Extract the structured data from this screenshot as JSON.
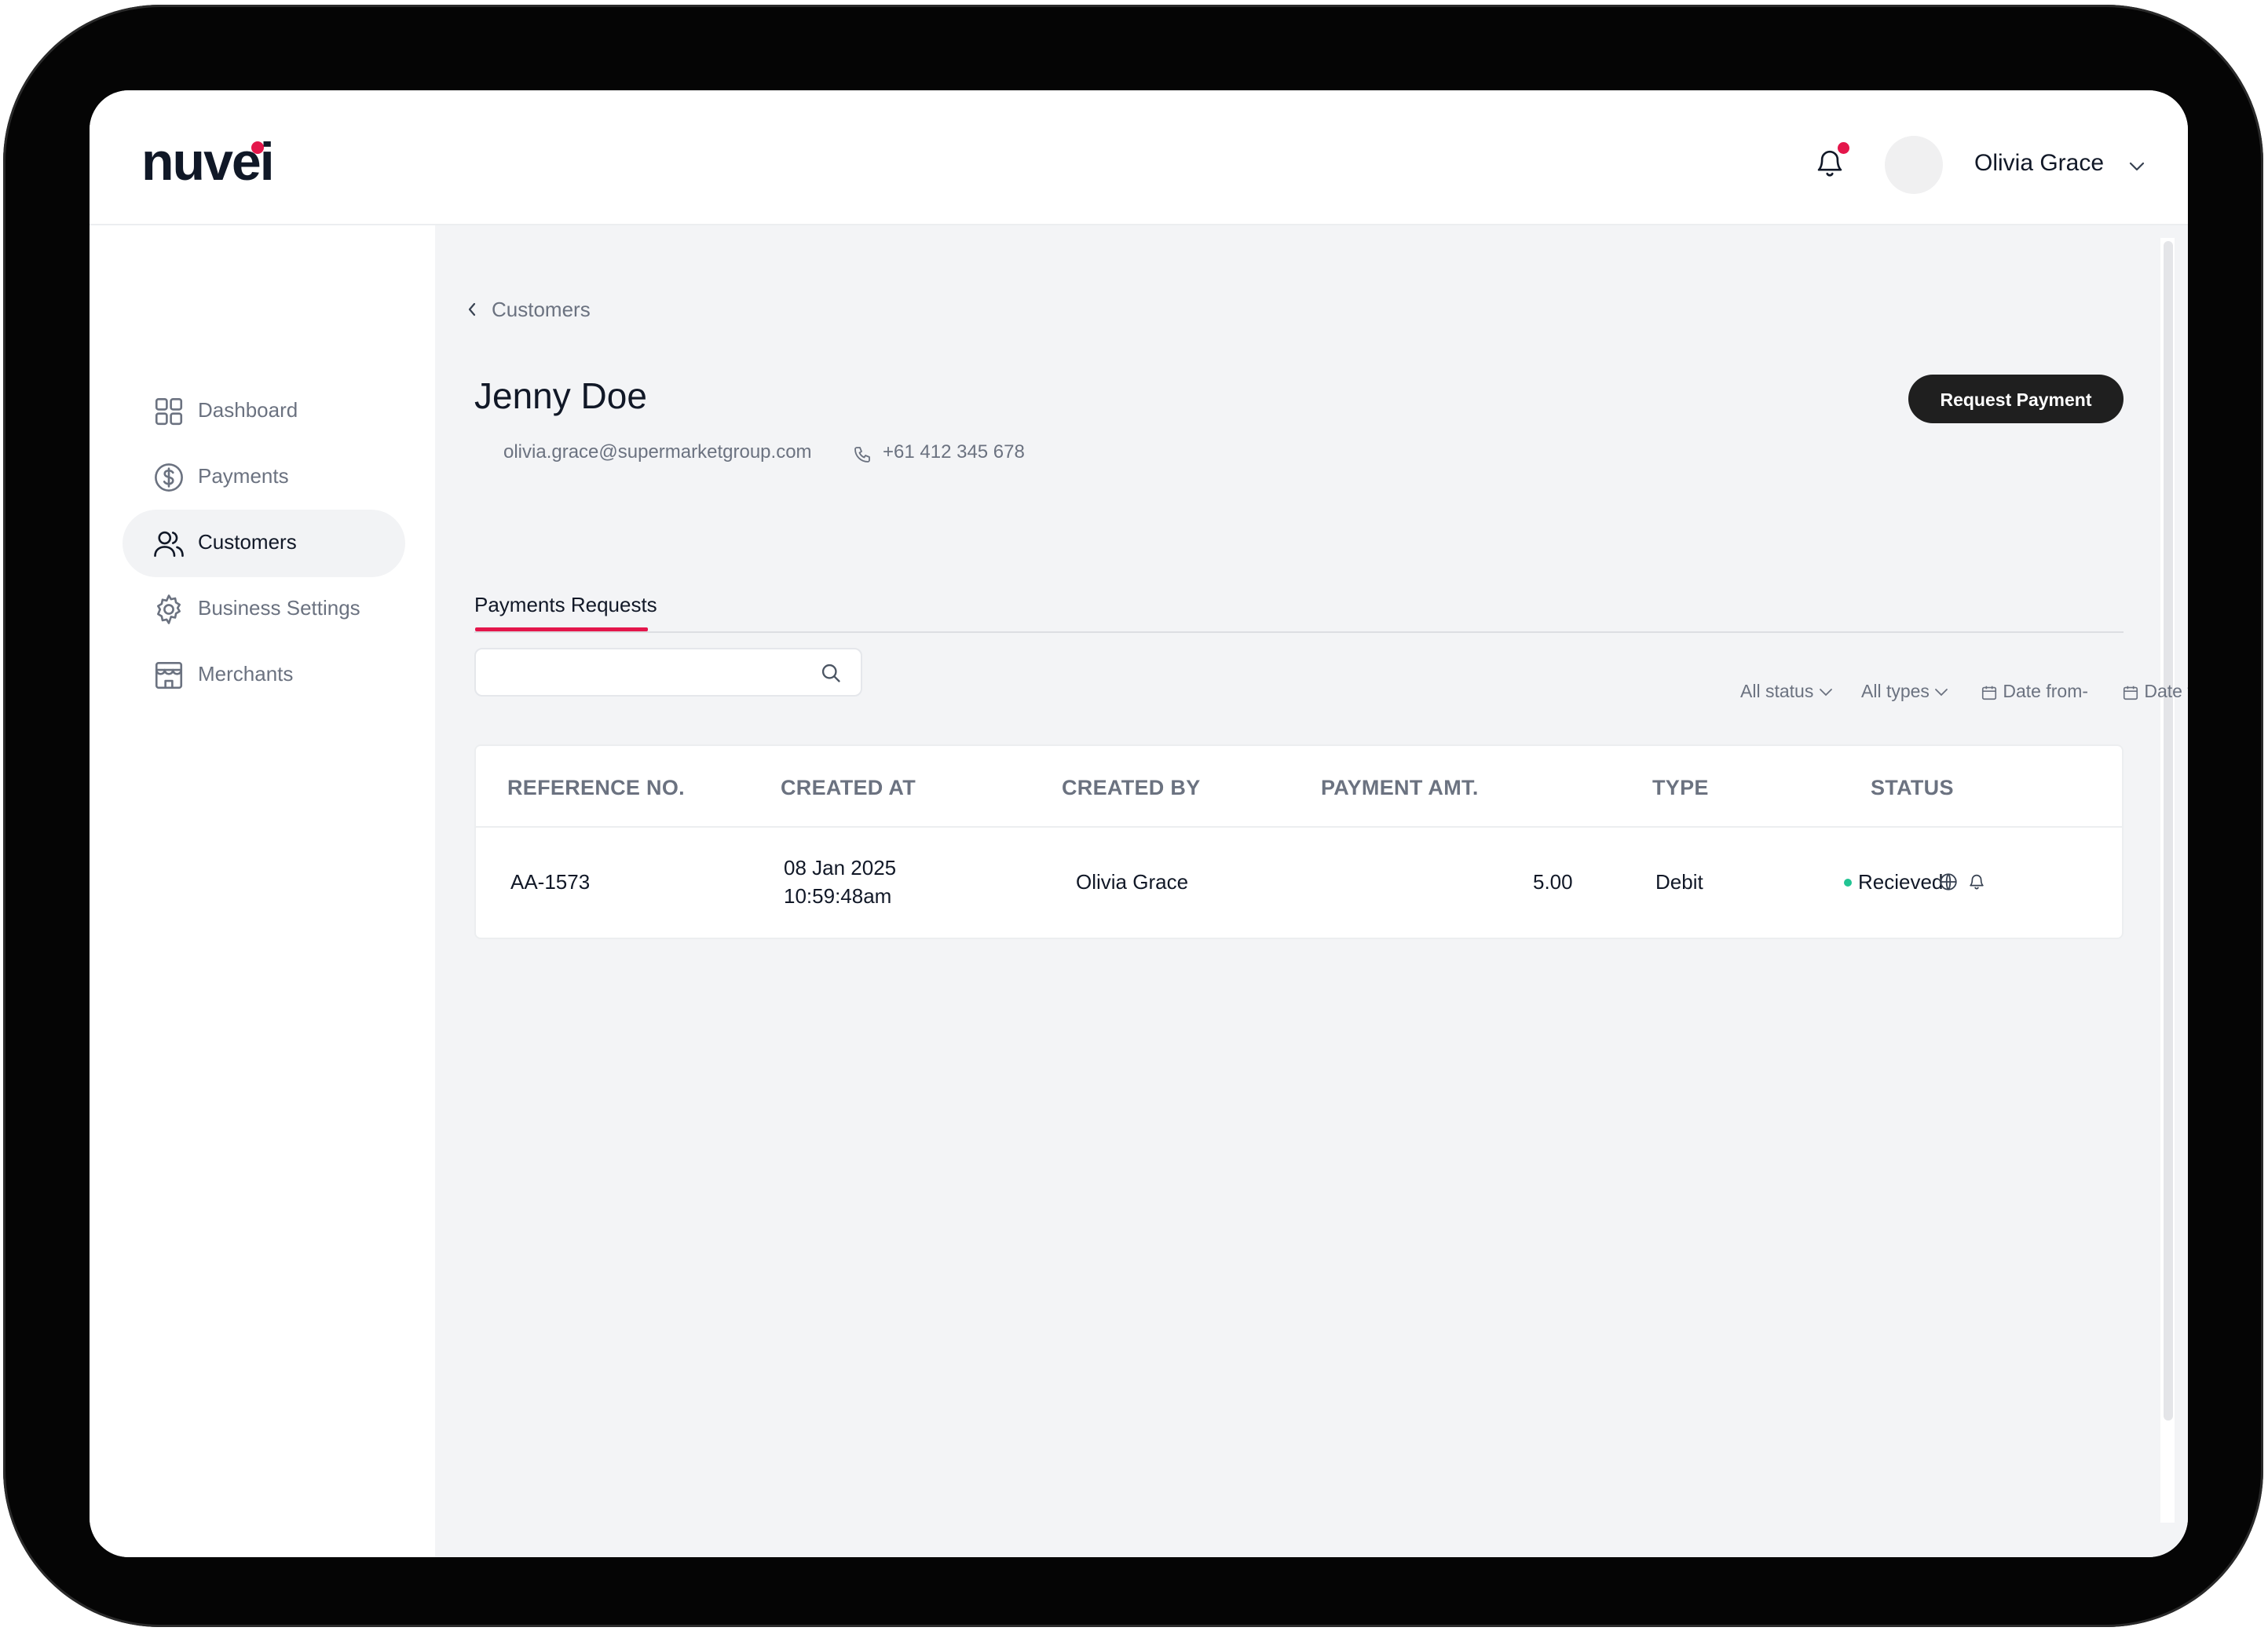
{
  "brand": {
    "logo_text": "nuvei",
    "accent_color": "#e4164b"
  },
  "header": {
    "user_name": "Olivia Grace",
    "notification_badge_color": "#e4164b"
  },
  "sidebar": {
    "items": [
      {
        "label": "Dashboard",
        "icon": "grid-icon",
        "active": false
      },
      {
        "label": "Payments",
        "icon": "dollar-circle-icon",
        "active": false
      },
      {
        "label": "Customers",
        "icon": "users-icon",
        "active": true
      },
      {
        "label": "Business Settings",
        "icon": "gear-icon",
        "active": false
      },
      {
        "label": "Merchants",
        "icon": "store-icon",
        "active": false
      }
    ]
  },
  "breadcrumb": {
    "back_label": "Customers"
  },
  "customer": {
    "name": "Jenny Doe",
    "email": "olivia.grace@supermarketgroup.com",
    "phone": "+61 412 345 678"
  },
  "actions": {
    "request_payment_label": "Request Payment"
  },
  "tabs": [
    {
      "label": "Payments Requests",
      "active": true
    }
  ],
  "search": {
    "placeholder": ""
  },
  "filters": {
    "status": "All status",
    "types": "All types",
    "date_from": "Date from-",
    "date_to": "Date to"
  },
  "table": {
    "columns": [
      "REFERENCE NO.",
      "CREATED AT",
      "CREATED BY",
      "PAYMENT AMT.",
      "TYPE",
      "STATUS"
    ],
    "rows": [
      {
        "reference": "AA-1573",
        "created_date": "08 Jan 2025",
        "created_time": "10:59:48am",
        "created_by": "Olivia Grace",
        "amount": "5.00",
        "type": "Debit",
        "status": "Recieved",
        "status_color": "#22c493"
      }
    ]
  }
}
